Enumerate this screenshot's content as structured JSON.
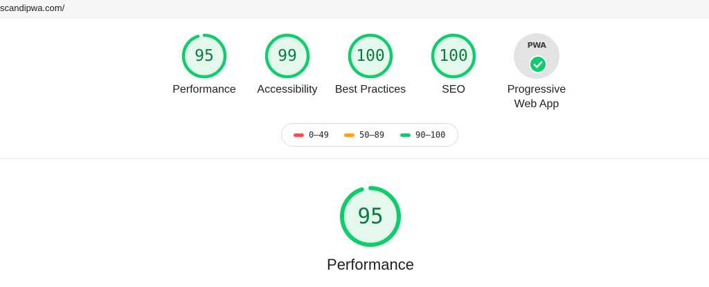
{
  "url": "scandipwa.com/",
  "categories": [
    {
      "id": "performance",
      "label": "Performance",
      "score": "95",
      "value": 95
    },
    {
      "id": "accessibility",
      "label": "Accessibility",
      "score": "99",
      "value": 99
    },
    {
      "id": "best-practices",
      "label": "Best Practices",
      "score": "100",
      "value": 100
    },
    {
      "id": "seo",
      "label": "SEO",
      "score": "100",
      "value": 100
    }
  ],
  "pwa": {
    "badge_text": "PWA",
    "label_line1": "Progressive",
    "label_line2": "Web App"
  },
  "legend": [
    {
      "range": "0–49",
      "color": "#ff4e42"
    },
    {
      "range": "50–89",
      "color": "#ffa400"
    },
    {
      "range": "90–100",
      "color": "#0cce6b"
    }
  ],
  "main_gauge": {
    "label": "Performance",
    "score": "95",
    "value": 95
  },
  "colors": {
    "pass": "#0cce6b",
    "pass_fill": "#e5f8ee",
    "pass_text": "#0a7c41"
  }
}
